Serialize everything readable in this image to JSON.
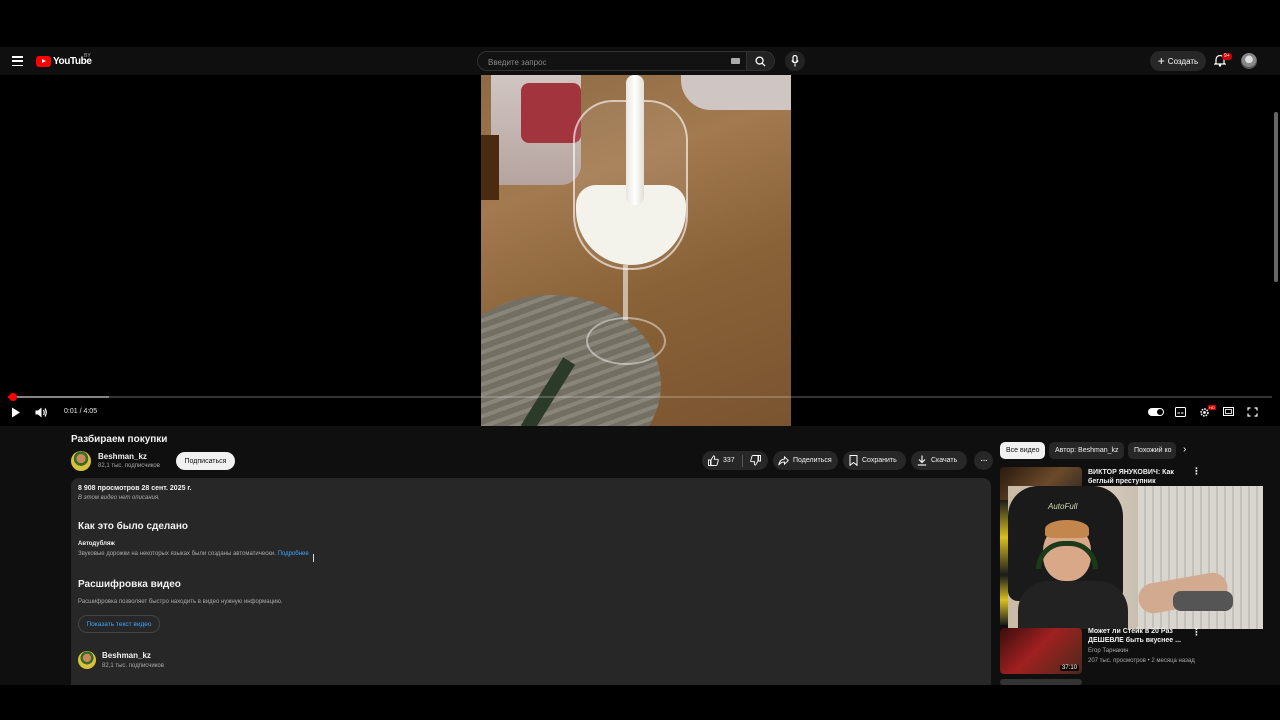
{
  "header": {
    "logo_text": "YouTube",
    "region": "BY",
    "search_placeholder": "Введите запрос",
    "create_label": "Создать",
    "notifications_badge": "9+"
  },
  "player": {
    "time": "0:01 / 4:05",
    "progress_played": 0.004,
    "progress_buffered": 0.08
  },
  "video": {
    "title": "Разбираем покупки",
    "channel": "Beshman_kz",
    "subscribers": "82,1 тыс. подписчиков",
    "subscribe_label": "Подписаться",
    "likes": "337",
    "share_label": "Поделиться",
    "save_label": "Сохранить",
    "download_label": "Скачать"
  },
  "description": {
    "meta": "8 908 просмотров  28 сент. 2025 г.",
    "empty_text": "В этом видео нет описания.",
    "how_made_heading": "Как это было сделано",
    "autodub_title": "Автодубляж",
    "autodub_text": "Звуковые дорожки на некоторых языках были созданы автоматически.",
    "autodub_link": "Подробнее",
    "transcript_heading": "Расшифровка видео",
    "transcript_text": "Расшифровка позволяет быстро находить в видео нужную информацию.",
    "transcript_button": "Показать текст видео",
    "channel": "Beshman_kz",
    "subscribers": "82,1 тыс. подписчиков"
  },
  "sidebar": {
    "chips": [
      "Все видео",
      "Автор: Beshman_kz",
      "Похожий ко"
    ],
    "recommendations": [
      {
        "title": "ВИКТОР ЯНУКОВИЧ: Как беглый преступник ограбил ...",
        "channel": "",
        "meta": "",
        "duration": ""
      },
      {
        "title": "Может ли Стейк в 20 Раз ДЕШЕВЛЕ быть вкуснее ...",
        "channel": "Егор Тарнакин",
        "meta": "207 тыс. просмотров • 2 месяца назад",
        "duration": "37:10"
      }
    ],
    "miniplayer_label": "AutoFull"
  },
  "colors": {
    "brand_red": "#ff0000",
    "background": "#0f0f0f",
    "link": "#3ea6ff"
  }
}
